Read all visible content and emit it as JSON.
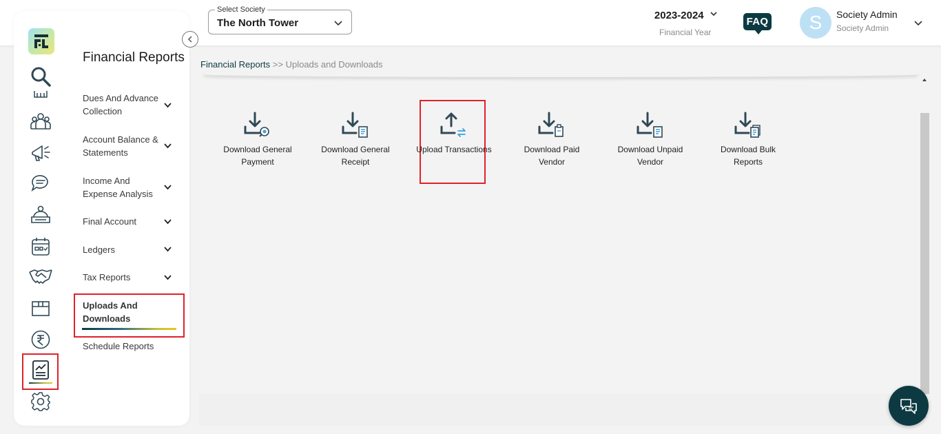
{
  "header": {
    "society_label": "Select Society",
    "society_value": "The North Tower",
    "financial_year": "2023-2024",
    "financial_year_label": "Financial Year",
    "faq_label": "FAQ",
    "avatar_initial": "S",
    "user_name": "Society Admin",
    "user_role": "Society Admin"
  },
  "sidebar": {
    "title": "Financial Reports",
    "items": [
      {
        "label": "Dues And Advance Collection",
        "expandable": true
      },
      {
        "label": "Account Balance & Statements",
        "expandable": true
      },
      {
        "label": "Income And Expense Analysis",
        "expandable": true
      },
      {
        "label": "Final Account",
        "expandable": true
      },
      {
        "label": "Ledgers",
        "expandable": true
      },
      {
        "label": "Tax Reports",
        "expandable": true
      },
      {
        "label": "Uploads And Downloads",
        "expandable": false,
        "active": true
      },
      {
        "label": "Schedule Reports",
        "expandable": false
      }
    ],
    "rail_icons": [
      "search-icon",
      "building-icon",
      "community-icon",
      "announcement-icon",
      "chat-bubbles-icon",
      "helpdesk-icon",
      "calendar-icon",
      "handshake-icon",
      "parcel-icon",
      "rupee-icon",
      "reports-icon",
      "settings-icon"
    ]
  },
  "breadcrumb": {
    "root": "Financial Reports",
    "separator": ">>",
    "current": "Uploads and Downloads"
  },
  "tiles": [
    {
      "label": "Download General Payment",
      "icon": "download-payment-icon"
    },
    {
      "label": "Download General Receipt",
      "icon": "download-receipt-icon"
    },
    {
      "label": "Upload Transactions",
      "icon": "upload-transactions-icon",
      "highlighted": true
    },
    {
      "label": "Download Paid Vendor",
      "icon": "download-paid-vendor-icon"
    },
    {
      "label": "Download Unpaid Vendor",
      "icon": "download-unpaid-vendor-icon"
    },
    {
      "label": "Download Bulk Reports",
      "icon": "download-bulk-reports-icon"
    }
  ],
  "colors": {
    "primary_dark": "#0d3a42",
    "icon_slate": "#2f4856",
    "highlight_red": "#e0202a",
    "accent_blue": "#3aa0e0"
  }
}
